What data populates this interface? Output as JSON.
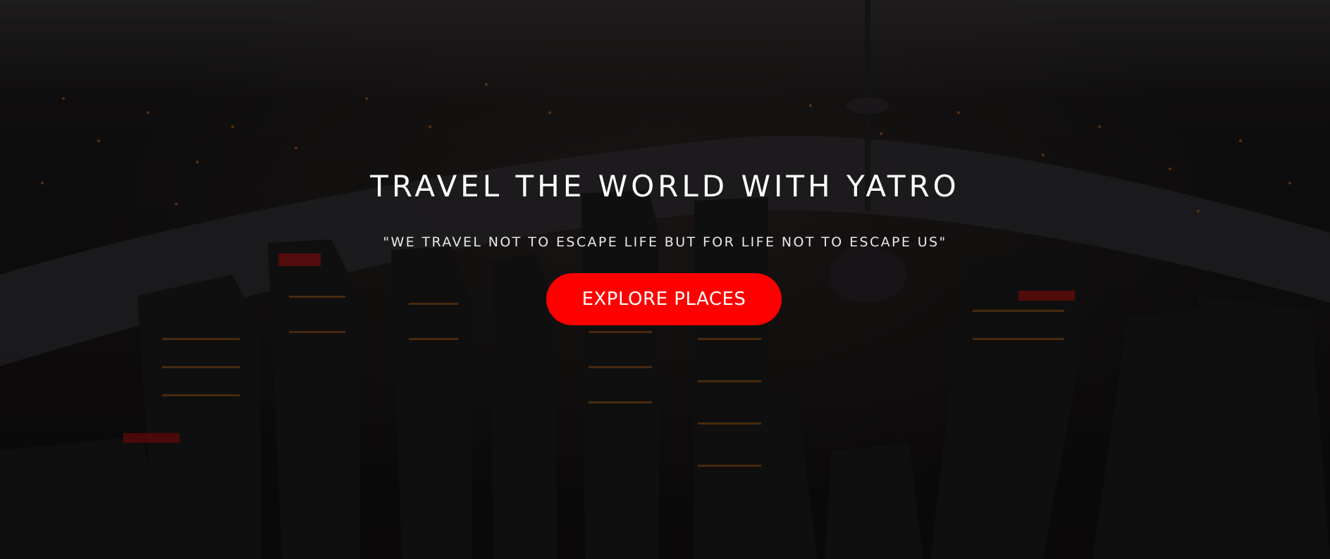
{
  "hero": {
    "headline": "TRAVEL THE WORLD WITH YATRO",
    "quote": "\"WE TRAVEL NOT TO ESCAPE LIFE BUT FOR LIFE NOT TO ESCAPE US\"",
    "cta_label": "EXPLORE PLACES"
  },
  "colors": {
    "accent": "#ff0000",
    "text": "#ffffff",
    "background": "#141213"
  }
}
